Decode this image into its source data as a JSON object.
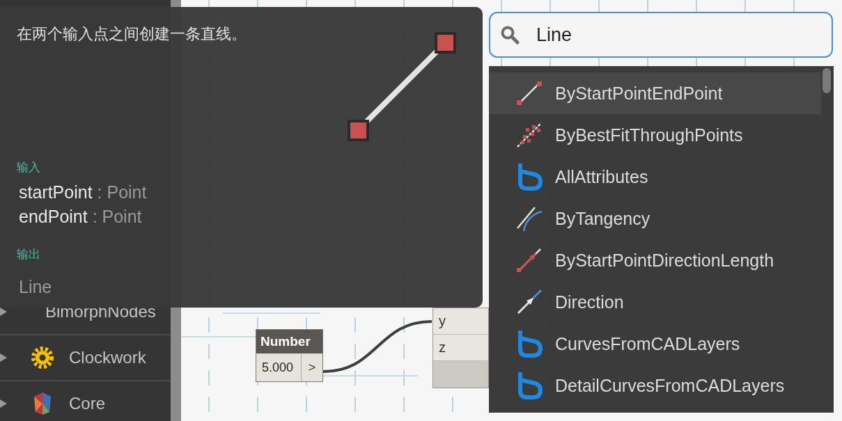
{
  "sidebar": {
    "items": [
      {
        "label": "BimorphNodes",
        "kind": "none",
        "expanded": false
      },
      {
        "label": "Clockwork",
        "kind": "gear",
        "expanded": false
      },
      {
        "label": "Core",
        "kind": "core",
        "expanded": false
      }
    ]
  },
  "canvas": {
    "number_node": {
      "title": "Number",
      "value": "5.000",
      "button": ">"
    },
    "point_node": {
      "ports": [
        "y",
        "z"
      ]
    }
  },
  "tooltip": {
    "description": "在两个输入点之间创建一条直线。",
    "inputs_heading": "输入",
    "inputs": [
      {
        "name": "startPoint",
        "type": ": Point"
      },
      {
        "name": "endPoint",
        "type": ": Point"
      }
    ],
    "outputs_heading": "输出",
    "output": "Line"
  },
  "search": {
    "value": "Line"
  },
  "results": [
    {
      "label": "ByStartPointEndPoint",
      "kind": "line",
      "selected": true
    },
    {
      "label": "ByBestFitThroughPoints",
      "kind": "fit",
      "selected": false
    },
    {
      "label": "AllAttributes",
      "kind": "package",
      "selected": false
    },
    {
      "label": "ByTangency",
      "kind": "tangent",
      "selected": false
    },
    {
      "label": "ByStartPointDirectionLength",
      "kind": "direction-length",
      "selected": false
    },
    {
      "label": "Direction",
      "kind": "direction",
      "selected": false
    },
    {
      "label": "CurvesFromCADLayers",
      "kind": "package",
      "selected": false
    },
    {
      "label": "DetailCurvesFromCADLayers",
      "kind": "package",
      "selected": false
    }
  ]
}
